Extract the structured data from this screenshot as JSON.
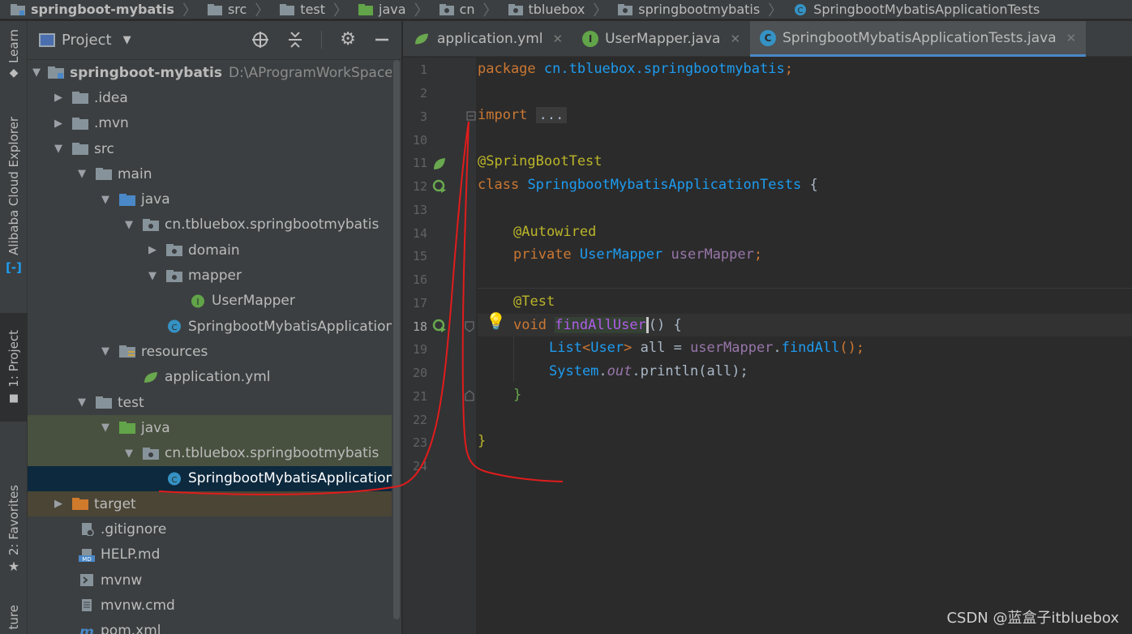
{
  "breadcrumb": {
    "items": [
      "springboot-mybatis",
      "src",
      "test",
      "java",
      "cn",
      "tbluebox",
      "springbootmybatis",
      "SpringbootMybatisApplicationTests"
    ]
  },
  "side_strip": {
    "learn": "Learn",
    "alibaba": "Alibaba Cloud Explorer",
    "project": "1: Project",
    "favorites": "2: Favorites",
    "structure": "ture"
  },
  "project_panel": {
    "title": "Project",
    "root_name": "springboot-mybatis",
    "root_path": "D:\\AProgramWorkSpace\\ide",
    "rows": [
      {
        "label": ".idea"
      },
      {
        "label": ".mvn"
      },
      {
        "label": "src"
      },
      {
        "label": "main"
      },
      {
        "label": "java"
      },
      {
        "label": "cn.tbluebox.springbootmybatis"
      },
      {
        "label": "domain"
      },
      {
        "label": "mapper"
      },
      {
        "label": "UserMapper"
      },
      {
        "label": "SpringbootMybatisApplication"
      },
      {
        "label": "resources"
      },
      {
        "label": "application.yml"
      },
      {
        "label": "test"
      },
      {
        "label": "java"
      },
      {
        "label": "cn.tbluebox.springbootmybatis"
      },
      {
        "label": "SpringbootMybatisApplicationT"
      },
      {
        "label": "target"
      },
      {
        "label": ".gitignore"
      },
      {
        "label": "HELP.md"
      },
      {
        "label": "mvnw"
      },
      {
        "label": "mvnw.cmd"
      },
      {
        "label": "pom.xml"
      }
    ]
  },
  "tabs": [
    {
      "label": "application.yml"
    },
    {
      "label": "UserMapper.java"
    },
    {
      "label": "SpringbootMybatisApplicationTests.java"
    }
  ],
  "editor": {
    "line_numbers": [
      "1",
      "2",
      "3",
      "10",
      "11",
      "12",
      "13",
      "14",
      "15",
      "16",
      "17",
      "18",
      "19",
      "20",
      "21",
      "22",
      "23",
      "24"
    ],
    "code": {
      "l1_kw": "package",
      "l1_pkg": "cn.tbluebox.springbootmybatis",
      "l1_semi": ";",
      "l3_kw": "import",
      "l3_fold": "...",
      "l11_ann": "@SpringBootTest",
      "l12_kw": "class",
      "l12_cls": "SpringbootMybatisApplicationTests",
      "l12_brace": "{",
      "l14_ann": "@Autowired",
      "l15_kw": "private",
      "l15_type": "UserMapper",
      "l15_name": "userMapper",
      "l15_semi": ";",
      "l17_ann": "@Test",
      "l18_kw": "void",
      "l18_name": "findAllUser",
      "l18_rest": "() {",
      "l19_type": "List",
      "l19_lt": "<",
      "l19_gen": "User",
      "l19_gt": ">",
      "l19_var": " all = ",
      "l19_obj": "userMapper",
      "l19_dot": ".",
      "l19_call": "findAll",
      "l19_end": "();",
      "l20_sys": "System",
      "l20_dot1": ".",
      "l20_out": "out",
      "l20_call": ".println(all);",
      "l21_close": "}",
      "l23_close": "}"
    }
  },
  "watermark": "CSDN @蓝盒子itbluebox",
  "colors": {
    "annotation": "#bbb529",
    "keyword": "#cc7832",
    "type": "#1e9cf0",
    "selection": "#0d293e",
    "red_mark": "#e11c1c"
  }
}
